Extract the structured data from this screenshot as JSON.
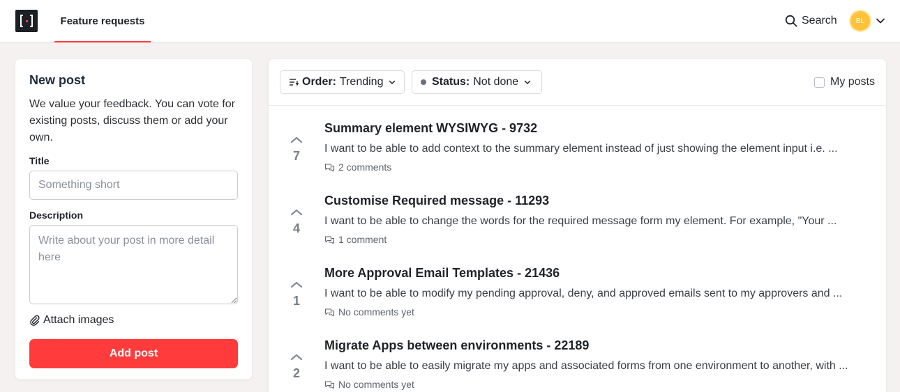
{
  "header": {
    "tab_label": "Feature requests",
    "search_label": "Search",
    "avatar_initials": "BL",
    "accent_color": "#ff3b3b",
    "avatar_color": "#ffc23a"
  },
  "new_post": {
    "title": "New post",
    "description": "We value your feedback. You can vote for existing posts, discuss them or add your own.",
    "title_label": "Title",
    "title_placeholder": "Something short",
    "description_label": "Description",
    "description_placeholder": "Write about your post in more detail here",
    "attach_label": "Attach images",
    "submit_label": "Add post"
  },
  "filters": {
    "order_key": "Order:",
    "order_value": "Trending",
    "status_key": "Status:",
    "status_value": "Not done",
    "my_posts_label": "My posts"
  },
  "posts": [
    {
      "votes": "7",
      "title": "Summary element WYSIWYG - 9732",
      "excerpt": "I want to be able to add context to the summary element instead of just showing the element input i.e. ...",
      "comments": "2 comments"
    },
    {
      "votes": "4",
      "title": "Customise Required message - 11293",
      "excerpt": "I want to be able to change the words for the required message form my element. For example, \"Your ...",
      "comments": "1 comment"
    },
    {
      "votes": "1",
      "title": "More Approval Email Templates - 21436",
      "excerpt": "I want to be able to modify my pending approval, deny, and approved emails sent to my approvers and ...",
      "comments": "No comments yet"
    },
    {
      "votes": "2",
      "title": "Migrate Apps between environments - 22189",
      "excerpt": "I want to be able to easily migrate my apps and associated forms from one environment to another, with ...",
      "comments": "No comments yet"
    }
  ]
}
